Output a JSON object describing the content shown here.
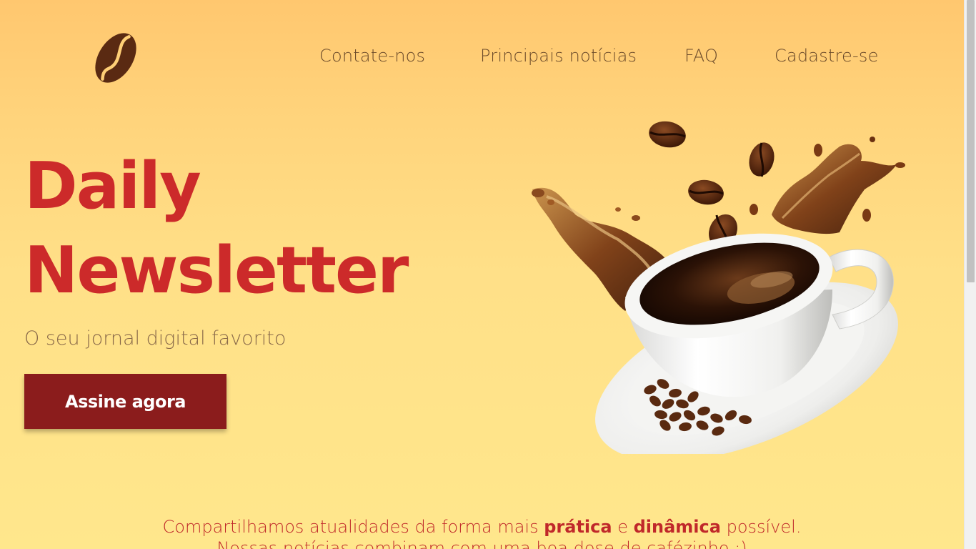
{
  "header": {
    "logo_icon": "coffee-bean-icon",
    "nav": [
      {
        "label": "Contate-nos"
      },
      {
        "label": "Principais notícias"
      },
      {
        "label": "FAQ"
      },
      {
        "label": "Cadastre-se"
      }
    ]
  },
  "hero": {
    "title_line1": "Daily",
    "title_line2": "Newsletter",
    "subtitle": "O seu jornal digital favorito",
    "cta_label": "Assine agora",
    "illustration_icon": "coffee-cup-splash-icon"
  },
  "tagline": {
    "line1_part1": "Compartilhamos atualidades da forma mais ",
    "line1_bold1": "prática",
    "line1_part2": " e ",
    "line1_bold2": "dinâmica",
    "line1_part3": " possível.",
    "line2": "Nossas notícias combinam com uma boa dose de cafézinho :)"
  },
  "colors": {
    "accent": "#cc2a2a",
    "button": "#8b1c1c",
    "nav_text": "#6b4a2a",
    "background_top": "#ffc76f",
    "background_bottom": "#ffe78c"
  }
}
